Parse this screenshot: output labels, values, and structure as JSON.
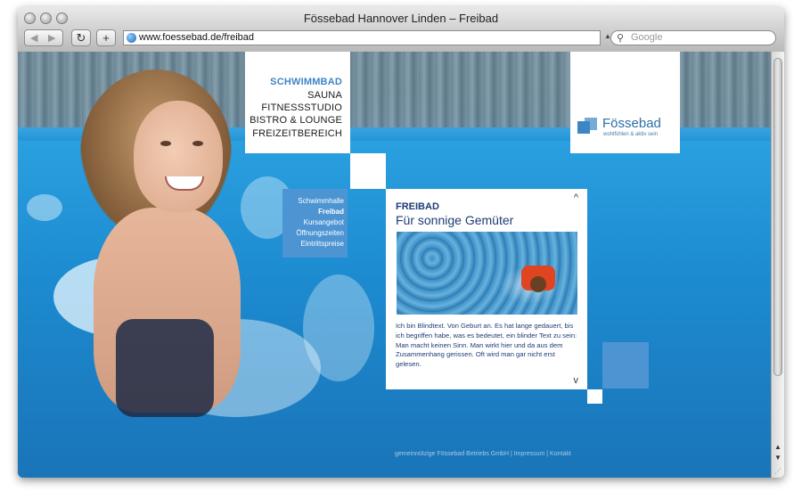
{
  "window": {
    "title": "Fössebad Hannover Linden – Freibad"
  },
  "toolbar": {
    "back_icon": "◀",
    "forward_icon": "▶",
    "reload_icon": "↻",
    "add_icon": "+",
    "url": "www.foessebad.de/freibad",
    "search_placeholder": "Google",
    "search_icon": "🔍"
  },
  "main_nav": {
    "items": [
      {
        "label": "SCHWIMMBAD",
        "active": true
      },
      {
        "label": "SAUNA"
      },
      {
        "label": "FITNESSSTUDIO"
      },
      {
        "label": "BISTRO & LOUNGE"
      },
      {
        "label": "FREIZEITBEREICH"
      }
    ]
  },
  "logo": {
    "name": "Fössebad",
    "tagline": "wohlfühlen & aktiv sein"
  },
  "sub_nav": {
    "items": [
      {
        "label": "Schwimmhalle"
      },
      {
        "label": "Freibad",
        "active": true
      },
      {
        "label": "Kursangebot"
      },
      {
        "label": "Öffnungszeiten"
      },
      {
        "label": "Eintrittspreise"
      }
    ]
  },
  "card": {
    "heading": "FREIBAD",
    "subheading": "Für sonnige Gemüter",
    "body": "Ich bin Blindtext. Von Geburt an. Es hat lange gedauert, bis ich begriffen habe, was es bedeutet, ein blinder Text zu sein: Man macht keinen Sinn. Man wirkt hier und da aus dem Zusammenhang gerissen. Oft wird man gar nicht erst gelesen.",
    "up_icon": "^",
    "down_icon": "v"
  },
  "footer": {
    "text": "gemeinnützige Fössebad Betriebs GmbH | Impressum | Kontakt"
  },
  "colors": {
    "brand_blue": "#3d86c6",
    "text_navy": "#1d3c77"
  }
}
